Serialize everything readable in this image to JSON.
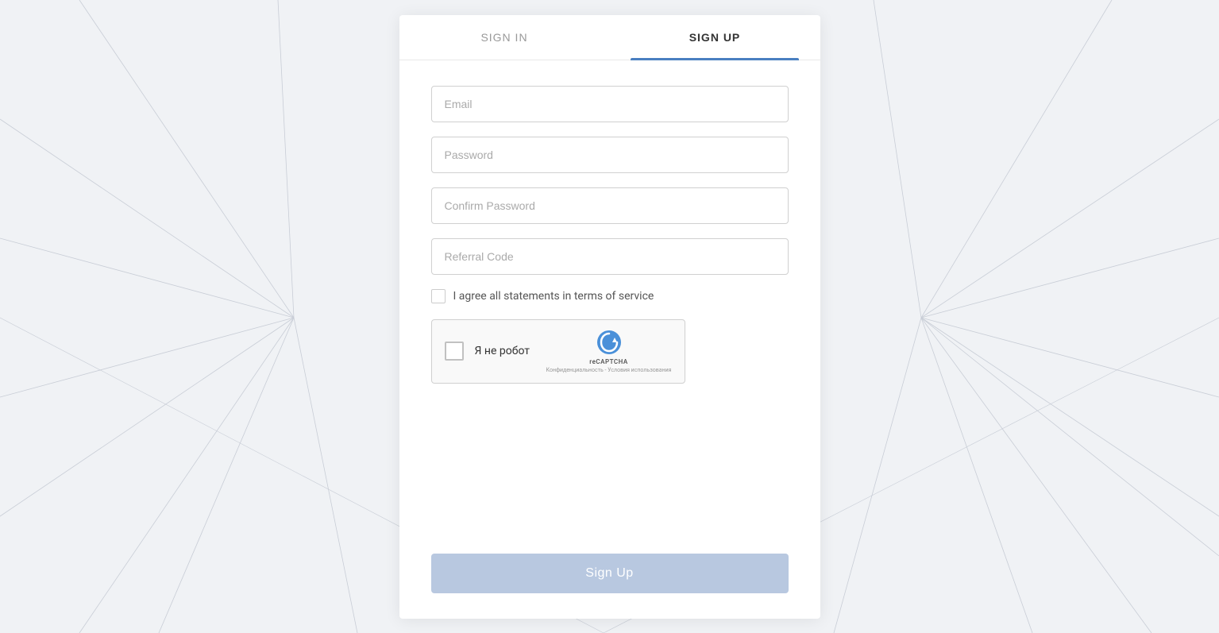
{
  "tabs": {
    "signin": {
      "label": "SIGN IN"
    },
    "signup": {
      "label": "SIGN UP"
    }
  },
  "form": {
    "email_placeholder": "Email",
    "password_placeholder": "Password",
    "confirm_password_placeholder": "Confirm Password",
    "referral_code_placeholder": "Referral Code",
    "terms_label": "I agree all statements in terms of service",
    "recaptcha_label": "Я не робот",
    "recaptcha_brand": "reCAPTCHA",
    "recaptcha_sub": "Конфиденциальность - Условия использования",
    "submit_label": "Sign Up"
  },
  "background": {
    "line_color": "#c8cdd6"
  }
}
